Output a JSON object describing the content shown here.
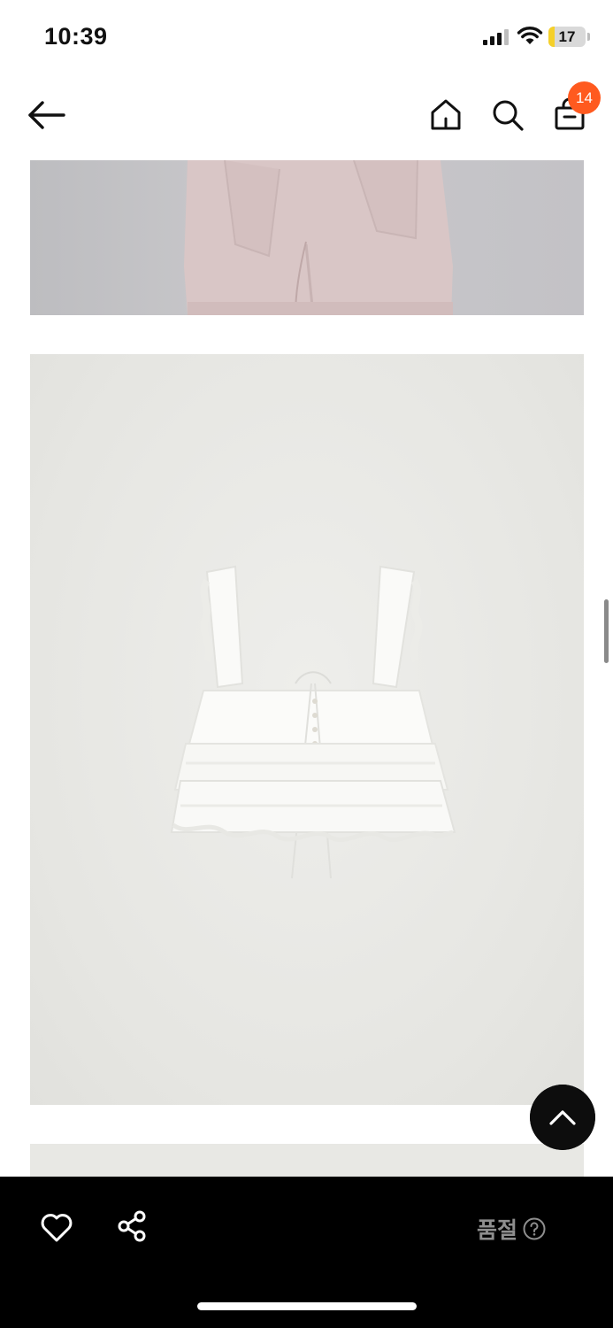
{
  "status_bar": {
    "time": "10:39",
    "battery_level": "17",
    "battery_percent": 17,
    "icons": [
      "signal-icon",
      "wifi-icon",
      "battery-icon"
    ]
  },
  "header": {
    "icons": [
      "back-arrow-icon",
      "home-icon",
      "search-icon",
      "shopping-bag-icon"
    ],
    "cart_count": "14",
    "badge_color": "#ff5a1f"
  },
  "bottom_bar": {
    "icons": [
      "heart-icon",
      "share-icon",
      "help-icon"
    ],
    "status_label": "품절",
    "status_color": "#8e8e8e"
  },
  "floating": {
    "icon": "chevron-up-icon"
  }
}
